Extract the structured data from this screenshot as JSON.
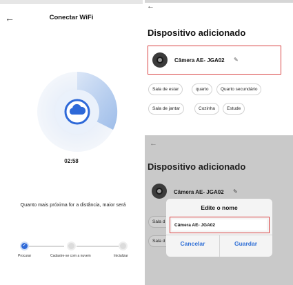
{
  "wifi_screen": {
    "title": "Conectar WiFi",
    "timer": "02:58",
    "hint": "Quanto mais próxima for a distância, maior será",
    "steps": [
      {
        "label": "Procurar",
        "state": "done"
      },
      {
        "label": "Cadastre-se com a nuvem",
        "state": "pending"
      },
      {
        "label": "Inicializar",
        "state": "pending"
      }
    ],
    "accent_color": "#2e69d8"
  },
  "device_added": {
    "title": "Dispositivo adicionado",
    "device_name": "Câmera AE- JGA02",
    "rooms": [
      "Sala de estar",
      "quarto",
      "Quarto secundário",
      "Sala de jantar",
      "Cozinha",
      "Estude"
    ]
  },
  "edit_dialog": {
    "background_title": "Dispositivo adicionado",
    "background_device_name": "Câmera AE- JGA02",
    "background_rooms": [
      "Sala d",
      "Sala d"
    ],
    "title": "Edite o nome",
    "input_value": "Câmera AE- JGA02",
    "cancel_label": "Cancelar",
    "save_label": "Guardar"
  },
  "icons": {
    "back": "arrow-left-icon",
    "edit": "pencil-icon",
    "cloud": "cloud-icon",
    "camera": "camera-icon",
    "check": "check-icon"
  },
  "colors": {
    "highlight_border": "#d94040",
    "dialog_button": "#2f6fd6"
  }
}
